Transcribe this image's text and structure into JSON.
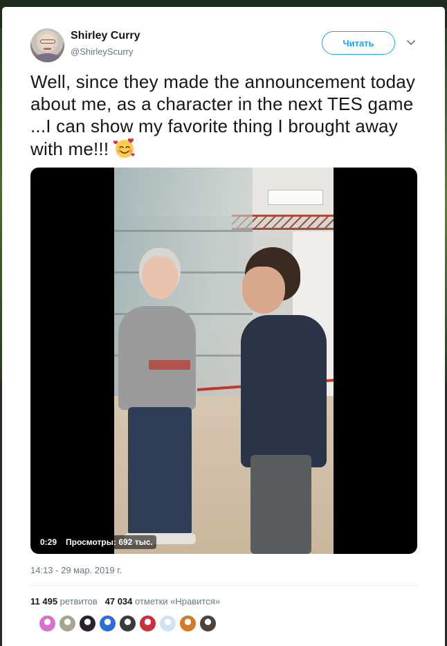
{
  "tweet": {
    "author": {
      "name": "Shirley Curry",
      "handle": "@ShirleyScurry"
    },
    "follow_label": "Читать",
    "text": "Well,  since they made the announcement today about me, as a character in the next TES game ...I can show my favorite thing I brought away with me!!!",
    "emoji": "smiling-face-with-hearts",
    "video": {
      "duration": "0:29",
      "views": "Просмотры: 692 тыс."
    },
    "timestamp": "14:13 - 29 мар. 2019 г.",
    "stats": {
      "retweets_count": "11 495",
      "retweets_label": "ретвитов",
      "likes_count": "47 034",
      "likes_label": "отметки «Нравится»"
    },
    "liker_avatars": [
      "#d96fcf",
      "#a8a393",
      "#2a2130",
      "#2b6fd6",
      "#3b3b3b",
      "#c8323a",
      "#cfe3f5",
      "#d27a2e",
      "#4d4338"
    ]
  },
  "colors": {
    "accent": "#1da1f2",
    "text_primary": "#14171a",
    "text_secondary": "#657786"
  }
}
